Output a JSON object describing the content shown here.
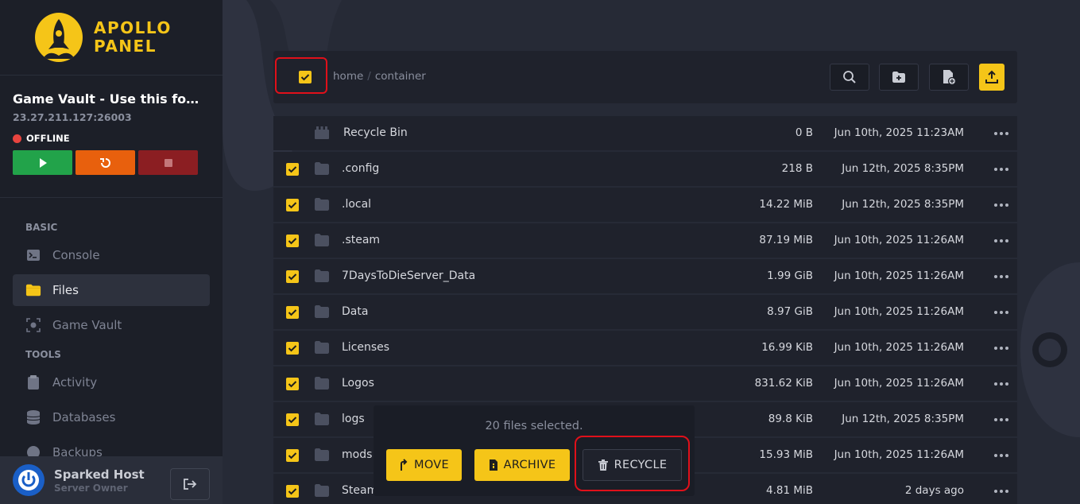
{
  "brand": {
    "line1": "APOLLO",
    "line2": "PANEL",
    "accent": "#f5c518"
  },
  "server": {
    "name": "Game Vault - Use this for ...",
    "address": "23.27.211.127:26003",
    "status": "OFFLINE",
    "status_color": "#e8443f"
  },
  "power": {
    "start_icon": "play-icon",
    "restart_icon": "restart-icon",
    "stop_icon": "stop-icon"
  },
  "nav": {
    "basic_heading": "BASIC",
    "basic_items": [
      {
        "label": "Console",
        "icon": "terminal-icon"
      },
      {
        "label": "Files",
        "icon": "folder-icon",
        "active": true
      },
      {
        "label": "Game Vault",
        "icon": "vault-icon"
      }
    ],
    "tools_heading": "TOOLS",
    "tools_items": [
      {
        "label": "Activity",
        "icon": "clipboard-icon"
      },
      {
        "label": "Databases",
        "icon": "database-icon"
      },
      {
        "label": "Backups",
        "icon": "backup-icon"
      }
    ]
  },
  "user": {
    "name": "Sparked Host",
    "role": "Server Owner"
  },
  "breadcrumb": {
    "part1": "home",
    "separator": "/",
    "part2": "container"
  },
  "toolbar": {
    "search_icon": "search-icon",
    "new_folder_icon": "folder-plus-icon",
    "new_file_icon": "file-plus-icon",
    "upload_icon": "upload-icon"
  },
  "files": [
    {
      "name": "Recycle Bin",
      "size": "0 B",
      "date": "Jun 10th, 2025 11:23AM",
      "type": "recycle"
    },
    {
      "name": ".config",
      "size": "218 B",
      "date": "Jun 12th, 2025 8:35PM",
      "type": "folder"
    },
    {
      "name": ".local",
      "size": "14.22 MiB",
      "date": "Jun 12th, 2025 8:35PM",
      "type": "folder"
    },
    {
      "name": ".steam",
      "size": "87.19 MiB",
      "date": "Jun 10th, 2025 11:26AM",
      "type": "folder"
    },
    {
      "name": "7DaysToDieServer_Data",
      "size": "1.99 GiB",
      "date": "Jun 10th, 2025 11:26AM",
      "type": "folder"
    },
    {
      "name": "Data",
      "size": "8.97 GiB",
      "date": "Jun 10th, 2025 11:26AM",
      "type": "folder"
    },
    {
      "name": "Licenses",
      "size": "16.99 KiB",
      "date": "Jun 10th, 2025 11:26AM",
      "type": "folder"
    },
    {
      "name": "Logos",
      "size": "831.62 KiB",
      "date": "Jun 10th, 2025 11:26AM",
      "type": "folder"
    },
    {
      "name": "logs",
      "size": "89.8 KiB",
      "date": "Jun 12th, 2025 8:35PM",
      "type": "folder"
    },
    {
      "name": "mods",
      "size": "15.93 MiB",
      "date": "Jun 10th, 2025 11:26AM",
      "type": "folder"
    },
    {
      "name": "Steam",
      "size": "4.81 MiB",
      "date": "2 days ago",
      "type": "folder"
    }
  ],
  "selection": {
    "count_text": "20 files selected.",
    "move_label": "MOVE",
    "archive_label": "ARCHIVE",
    "recycle_label": "RECYCLE"
  }
}
